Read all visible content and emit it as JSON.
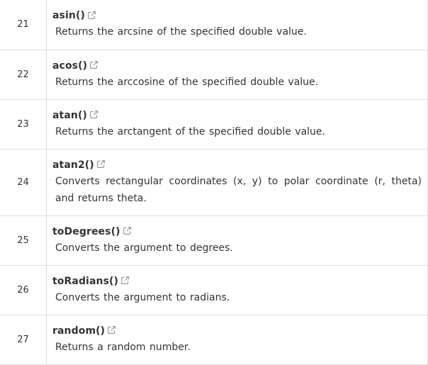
{
  "rows": [
    {
      "num": "21",
      "method": "asin()",
      "description": "Returns the arcsine of the specified double value."
    },
    {
      "num": "22",
      "method": "acos()",
      "description": "Returns the arccosine of the specified double value."
    },
    {
      "num": "23",
      "method": "atan()",
      "description": "Returns the arctangent of the specified double value."
    },
    {
      "num": "24",
      "method": "atan2()",
      "description": "Converts rectangular coordinates (x, y) to polar coordinate (r, theta) and returns theta."
    },
    {
      "num": "25",
      "method": "toDegrees()",
      "description": "Converts the argument to degrees."
    },
    {
      "num": "26",
      "method": "toRadians()",
      "description": "Converts the argument to radians."
    },
    {
      "num": "27",
      "method": "random()",
      "description": "Returns a random number."
    }
  ],
  "icons": {
    "external_link": "external-link-icon"
  },
  "colors": {
    "text": "#333333",
    "border": "#dddddd",
    "icon": "#999999"
  }
}
